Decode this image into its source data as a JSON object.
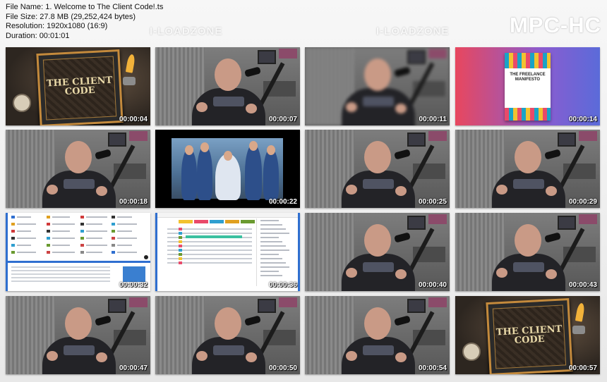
{
  "info": {
    "file_name": "File Name: 1. Welcome to The Client Code!.ts",
    "file_size": "File Size: 27.8 MB (29,252,424 bytes)",
    "resolution": "Resolution: 1920x1080 (16:9)",
    "duration": "Duration: 00:01:01"
  },
  "logo": "MPC-HC",
  "watermarks": [
    "I-LOADZONE",
    "I-LOADZONE"
  ],
  "box_title": "THE CLIENT CODE",
  "book_title": "THE FREELANCE MANIFESTO",
  "thumbnails": [
    {
      "time": "00:00:04",
      "scene": "box"
    },
    {
      "time": "00:00:07",
      "scene": "speaker"
    },
    {
      "time": "00:00:11",
      "scene": "speaker-blur"
    },
    {
      "time": "00:00:14",
      "scene": "book"
    },
    {
      "time": "00:00:18",
      "scene": "speaker"
    },
    {
      "time": "00:00:22",
      "scene": "tv"
    },
    {
      "time": "00:00:25",
      "scene": "speaker"
    },
    {
      "time": "00:00:29",
      "scene": "speaker"
    },
    {
      "time": "00:00:32",
      "scene": "web-dashboard"
    },
    {
      "time": "00:00:36",
      "scene": "web-table"
    },
    {
      "time": "00:00:40",
      "scene": "speaker"
    },
    {
      "time": "00:00:43",
      "scene": "speaker"
    },
    {
      "time": "00:00:47",
      "scene": "speaker"
    },
    {
      "time": "00:00:50",
      "scene": "speaker"
    },
    {
      "time": "00:00:54",
      "scene": "speaker"
    },
    {
      "time": "00:00:57",
      "scene": "box"
    }
  ]
}
